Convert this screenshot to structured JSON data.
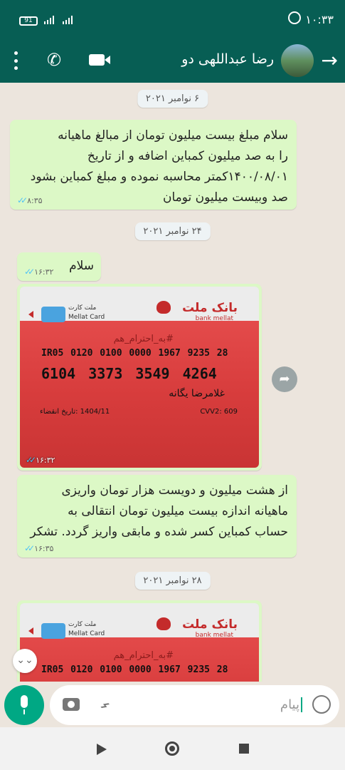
{
  "status_bar": {
    "time": "۱۰:۳۳",
    "battery": "91"
  },
  "header": {
    "contact_name": "رضا عبداللهی دو",
    "back_icon": "arrow-back-icon",
    "video_icon": "video-call-icon",
    "call_icon": "phone-icon",
    "menu_icon": "more-vert-icon"
  },
  "messages": {
    "date1": "۶ نوامبر ۲۰۲۱",
    "m1_text": "سلام مبلغ بیست میلیون تومان از مبالغ ماهیانه\nرا به صد میلیون کمباین اضافه و از تاریخ\n۱۴۰۰/۰۸/۰۱کمتر محاسبه نموده و مبلغ کمباین بشود\nصد وبیست میلیون تومان",
    "m1_time": "۸:۳۵",
    "date2": "۲۴ نوامبر ۲۰۲۱",
    "m2_text": "سلام",
    "m2_time": "۱۶:۳۲",
    "m3_time": "۱۶:۳۲",
    "m4_text": "از هشت میلیون و دویست هزار تومان واریزی\nماهیانه اندازه بیست میلیون تومان انتقالی به\nحساب کمباین کسر شده و مابقی واریز گردد. تشکر",
    "m4_time": "۱۶:۳۵",
    "date3": "۲۸ نوامبر ۲۰۲۱"
  },
  "card": {
    "bank_name": "بانک ملت",
    "bank_name_en": "bank mellat",
    "card_label": "ملت کارت",
    "card_label_en": "Mellat Card",
    "slogan": "#به_احترام_هم",
    "iban": "IR05 0120 0100 0000 1967 9235 28",
    "number": "6104 3373 3549 4264",
    "holder": "غلامرضا یگانه",
    "expiry": "1404/11 :تاریخ انقضاء",
    "cvv2": "CVV2: 609"
  },
  "input": {
    "placeholder": "پیام"
  }
}
